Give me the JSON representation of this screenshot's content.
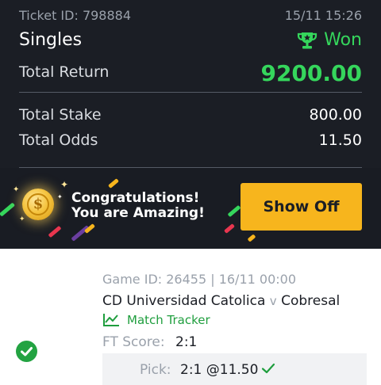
{
  "ticket": {
    "id_text": "Ticket ID: 798884",
    "datetime": "15/11 15:26",
    "bet_type": "Singles",
    "status": "Won",
    "total_return_label": "Total Return",
    "total_return_value": "9200.00",
    "total_stake_label": "Total Stake",
    "total_stake_value": "800.00",
    "total_odds_label": "Total Odds",
    "total_odds_value": "11.50"
  },
  "banner": {
    "line1": "Congratulations!",
    "line2": "You are Amazing!",
    "button_label": "Show Off",
    "coin_symbol": "$"
  },
  "match": {
    "game_id_text": "Game ID: 26455 | 16/11 00:00",
    "home_team": "CD Universidad Catolica",
    "vs": "v",
    "away_team": "Cobresal",
    "tracker_label": "Match Tracker",
    "ft_score_label": "FT Score:",
    "ft_score_value": "2:1",
    "pick_label": "Pick:",
    "pick_value": "2:1 @11.50"
  },
  "icons": {
    "trophy": "trophy-icon",
    "tracker": "chart-line-icon",
    "check": "check-icon",
    "status_check": "check-circle-icon"
  },
  "colors": {
    "won_green": "#35d65c",
    "accent_yellow": "#f7b51d",
    "tracker_green": "#1f9e3e",
    "dark_bg": "#1b1e25"
  }
}
